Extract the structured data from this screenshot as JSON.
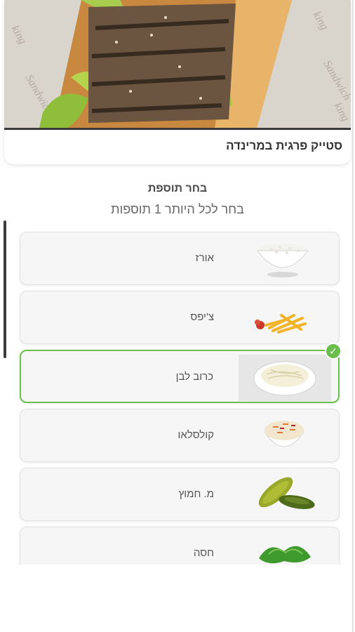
{
  "dish": {
    "title": "סטייק פרגית במרינדה"
  },
  "addons": {
    "title": "בחר תוספת",
    "subtitle": "בחר לכל היותר 1 תוספות",
    "items": [
      {
        "label": "אורז",
        "icon": "rice-bowl-icon",
        "selected": false
      },
      {
        "label": "צ'יפס",
        "icon": "fries-icon",
        "selected": false
      },
      {
        "label": "כרוב לבן",
        "icon": "white-cabbage-icon",
        "selected": true
      },
      {
        "label": "קולסלאו",
        "icon": "coleslaw-icon",
        "selected": false
      },
      {
        "label": "מ. חמוץ",
        "icon": "pickles-icon",
        "selected": false
      },
      {
        "label": "חסה",
        "icon": "lettuce-icon",
        "selected": false
      }
    ]
  },
  "colors": {
    "selected_border": "#6cbf4e",
    "card_background": "#f6f6f6"
  }
}
